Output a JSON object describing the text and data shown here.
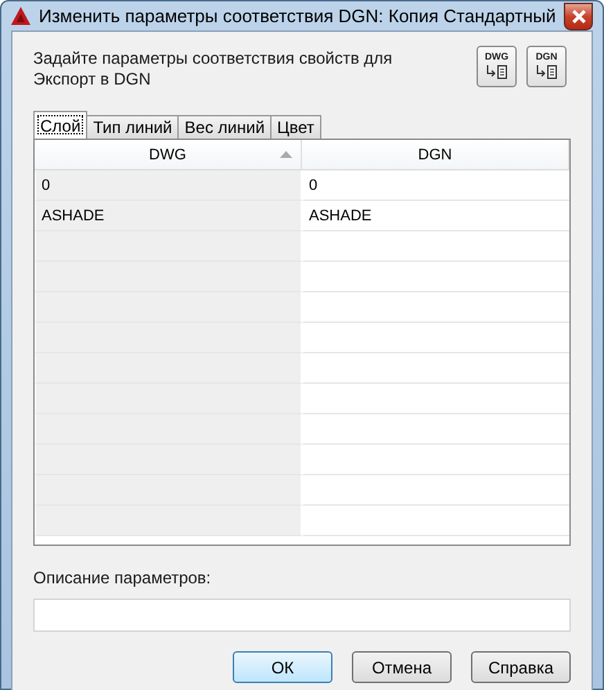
{
  "window": {
    "title": "Изменить параметры соответствия DGN:  Копия Стандартный"
  },
  "intro": "Задайте параметры соответствия свойств для Экспорт в DGN",
  "tool_buttons": [
    {
      "label": "DWG"
    },
    {
      "label": "DGN"
    }
  ],
  "tabs": [
    {
      "label": "Слой",
      "selected": true
    },
    {
      "label": "Тип линий",
      "selected": false
    },
    {
      "label": "Вес линий",
      "selected": false
    },
    {
      "label": "Цвет",
      "selected": false
    }
  ],
  "table": {
    "columns": [
      {
        "label": "DWG",
        "sorted": true
      },
      {
        "label": "DGN",
        "sorted": false
      }
    ],
    "rows": [
      [
        "0",
        "0"
      ],
      [
        "ASHADE",
        "ASHADE"
      ]
    ]
  },
  "description": {
    "label": "Описание параметров:"
  },
  "buttons": [
    {
      "label": "ОК",
      "default": true
    },
    {
      "label": "Отмена",
      "default": false
    },
    {
      "label": "Справка",
      "default": false
    }
  ]
}
